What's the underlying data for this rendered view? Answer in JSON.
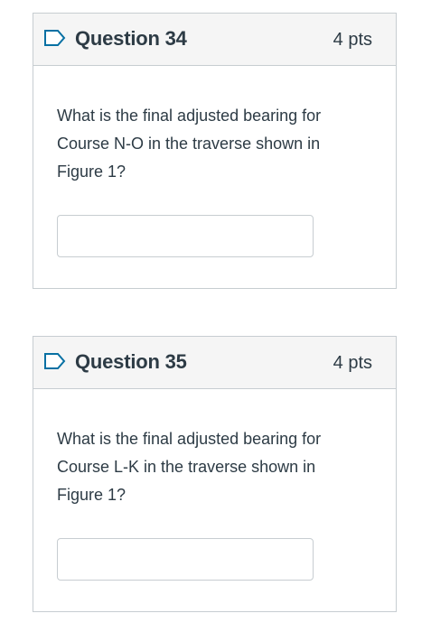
{
  "questions": [
    {
      "title": "Question 34",
      "points": "4 pts",
      "text": "What is the final adjusted bearing for Course N-O in the traverse shown in Figure 1?",
      "answer_value": ""
    },
    {
      "title": "Question 35",
      "points": "4 pts",
      "text": "What is the final adjusted bearing for Course L-K in the traverse shown in Figure 1?",
      "answer_value": ""
    }
  ],
  "colors": {
    "flag_icon": "#0770a3",
    "border": "#c7cdd1",
    "header_bg": "#f5f5f5",
    "text": "#2d3b45"
  },
  "icons": {
    "flag": "flag-icon"
  }
}
